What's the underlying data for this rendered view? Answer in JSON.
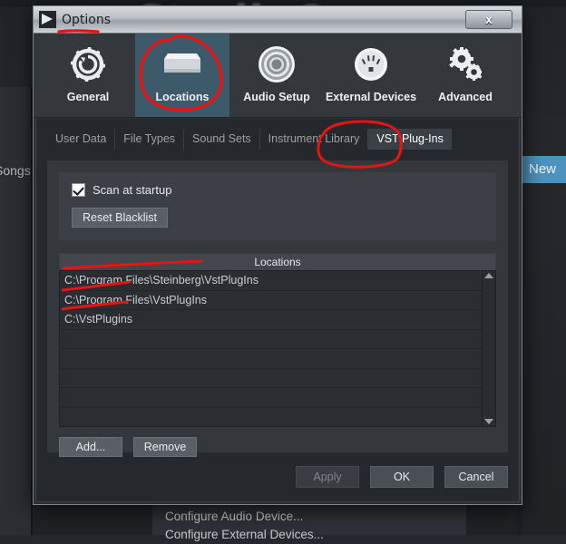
{
  "background": {
    "brand_text": "StudioOn",
    "songs_label": "Songs",
    "new_button_label": "New",
    "menu_items": [
      "Configure Audio Device...",
      "Configure External Devices..."
    ]
  },
  "dialog": {
    "title": "Options",
    "title_icon": "app-icon",
    "close_label": "x",
    "toolbar": [
      {
        "label": "General",
        "icon": "gear-refresh-icon",
        "active": false
      },
      {
        "label": "Locations",
        "icon": "hard-drive-icon",
        "active": true
      },
      {
        "label": "Audio Setup",
        "icon": "knob-dial-icon",
        "active": false
      },
      {
        "label": "External Devices",
        "icon": "midi-din-icon",
        "active": false
      },
      {
        "label": "Advanced",
        "icon": "double-gear-icon",
        "active": false
      }
    ],
    "tabs": [
      {
        "label": "User Data",
        "active": false
      },
      {
        "label": "File Types",
        "active": false
      },
      {
        "label": "Sound Sets",
        "active": false
      },
      {
        "label": "Instrument Library",
        "active": false
      },
      {
        "label": "VST Plug-Ins",
        "active": true
      }
    ],
    "options": {
      "scan_at_startup_label": "Scan at startup",
      "scan_at_startup_checked": true,
      "reset_blacklist_label": "Reset Blacklist"
    },
    "locations": {
      "header": "Locations",
      "rows": [
        "C:\\Program Files\\Steinberg\\VstPlugIns",
        "C:\\Program Files\\VstPlugIns",
        "C:\\VstPlugins"
      ],
      "add_label": "Add...",
      "remove_label": "Remove"
    },
    "footer": {
      "apply_label": "Apply",
      "apply_disabled": true,
      "ok_label": "OK",
      "cancel_label": "Cancel"
    }
  },
  "annotation": {
    "color": "#e81414",
    "marks": [
      "underline-options-title",
      "circle-locations-toolbar-item",
      "circle-vst-plugins-tab",
      "underline-location-row-1",
      "underline-location-row-2",
      "underline-location-row-3"
    ]
  }
}
